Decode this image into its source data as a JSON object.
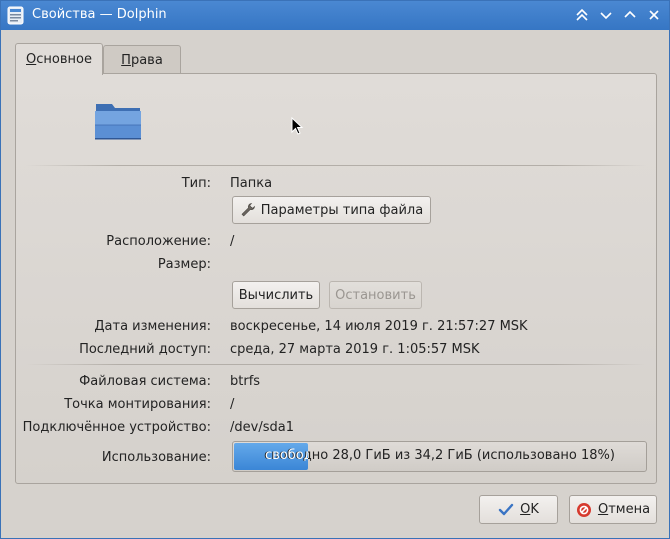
{
  "window": {
    "title": "Свойства — Dolphin"
  },
  "tabs": [
    {
      "label_u": "О",
      "label_rest": "сновное"
    },
    {
      "label_u": "П",
      "label_rest": "рава"
    }
  ],
  "general": {
    "type_label": "Тип:",
    "type_value": "Папка",
    "file_type_options_button": "Параметры типа файла",
    "location_label": "Расположение:",
    "location_value": "/",
    "size_label": "Размер:",
    "calculate_button": "Вычислить",
    "stop_button": "Остановить",
    "modified_label": "Дата изменения:",
    "modified_value": "воскресенье, 14 июля 2019 г. 21:57:27 MSK",
    "accessed_label": "Последний доступ:",
    "accessed_value": "среда, 27 марта 2019 г. 1:05:57 MSK",
    "filesystem_label": "Файловая система:",
    "filesystem_value": "btrfs",
    "mount_point_label": "Точка монтирования:",
    "mount_point_value": "/",
    "device_label": "Подключённое устройство:",
    "device_value": "/dev/sda1",
    "usage_label": "Использование:",
    "usage_text": "свободно 28,0 ГиБ из 34,2 ГиБ (использовано 18%)",
    "usage_percent": 18
  },
  "footer": {
    "ok_u": "O",
    "ok_rest": "K",
    "cancel_u": "О",
    "cancel_rest": "тмена"
  },
  "icons": {
    "app": "dolphin-properties-icon",
    "folder": "folder-icon",
    "wrench": "wrench-icon",
    "ok": "checkmark-icon",
    "cancel": "cancel-icon"
  }
}
